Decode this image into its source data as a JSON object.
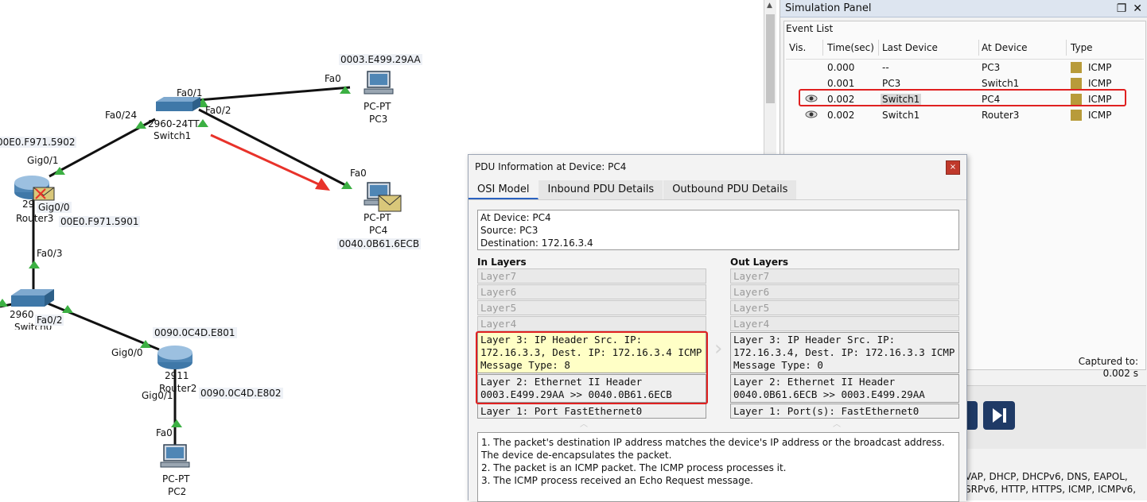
{
  "topology": {
    "devices": {
      "switch1": {
        "model": "2960-24TT",
        "name": "Switch1"
      },
      "pc3": {
        "model": "PC-PT",
        "name": "PC3",
        "mac": "0003.E499.29AA"
      },
      "pc4": {
        "model": "PC-PT",
        "name": "PC4",
        "mac": "0040.0B61.6ECB"
      },
      "router3": {
        "model": "29",
        "name": "Router3",
        "mac_top": "00E0.F971.5902",
        "mac_bottom": "00E0.F971.5901"
      },
      "switch0": {
        "model": "2960",
        "name": "Switch0"
      },
      "router2": {
        "model": "2911",
        "name": "Router2",
        "mac_top": "0090.0C4D.E801",
        "mac_bottom": "0090.0C4D.E802"
      },
      "pc2": {
        "model": "PC-PT",
        "name": "PC2"
      }
    },
    "ports": {
      "fa0_1": "Fa0/1",
      "fa0_2": "Fa0/2",
      "fa0_24": "Fa0/24",
      "pc3_fa0": "Fa0",
      "pc4_fa0": "Fa0",
      "gig0_1": "Gig0/1",
      "gig0_0": "Gig0/0",
      "fa0_3": "Fa0/3",
      "sw0_fa0_2": "Fa0/2",
      "r2_gig0_0": "Gig0/0",
      "r2_gig0_1": "Gig0/1",
      "pc2_fa0": "Fa0"
    }
  },
  "sim_panel": {
    "title": "Simulation Panel",
    "event_list_label": "Event List",
    "columns": [
      "Vis.",
      "Time(sec)",
      "Last Device",
      "At Device",
      "Type"
    ],
    "events": [
      {
        "time": "0.000",
        "last": "--",
        "at": "PC3",
        "type": "ICMP",
        "vis": false
      },
      {
        "time": "0.001",
        "last": "PC3",
        "at": "Switch1",
        "type": "ICMP",
        "vis": false
      },
      {
        "time": "0.002",
        "last": "Switch1",
        "at": "PC4",
        "type": "ICMP",
        "vis": true
      },
      {
        "time": "0.002",
        "last": "Switch1",
        "at": "Router3",
        "type": "ICMP",
        "vis": true
      }
    ],
    "captured_label": "Captured to:",
    "captured_value": "0.002 s",
    "filters_line1": "VAP, DHCP, DHCPv6, DNS, EAPOL,",
    "filters_line2": "SRPv6, HTTP, HTTPS, ICMP, ICMPv6,",
    "swatch_color": "#b89b3a"
  },
  "pdu": {
    "title": "PDU Information at Device: PC4",
    "close_glyph": "×",
    "tabs": [
      "OSI Model",
      "Inbound PDU Details",
      "Outbound PDU Details"
    ],
    "info": {
      "at_device": "At Device: PC4",
      "source": "Source: PC3",
      "destination": "Destination: 172.16.3.4"
    },
    "in_layers_label": "In Layers",
    "out_layers_label": "Out Layers",
    "in_layers": {
      "l7": "Layer7",
      "l6": "Layer6",
      "l5": "Layer5",
      "l4": "Layer4",
      "l3": "Layer 3: IP Header Src. IP: 172.16.3.3, Dest. IP: 172.16.3.4 ICMP Message Type: 8",
      "l2": "Layer 2: Ethernet II Header 0003.E499.29AA >> 0040.0B61.6ECB",
      "l1": "Layer 1: Port FastEthernet0"
    },
    "out_layers": {
      "l7": "Layer7",
      "l6": "Layer6",
      "l5": "Layer5",
      "l4": "Layer4",
      "l3": "Layer 3: IP Header Src. IP: 172.16.3.4, Dest. IP: 172.16.3.3 ICMP Message Type: 0",
      "l2": "Layer 2: Ethernet II Header 0040.0B61.6ECB >> 0003.E499.29AA",
      "l1": "Layer 1: Port(s): FastEthernet0"
    },
    "description": [
      "1. The packet's destination IP address matches the device's IP address or the broadcast address. The device de-encapsulates the packet.",
      "2. The packet is an ICMP packet. The ICMP process processes it.",
      "3. The ICMP process received an Echo Request message."
    ]
  },
  "colors": {
    "highlight": "#e02020",
    "link_green": "#3cb043",
    "arrow_red": "#e8322a",
    "tab_underline": "#2a62c0"
  }
}
